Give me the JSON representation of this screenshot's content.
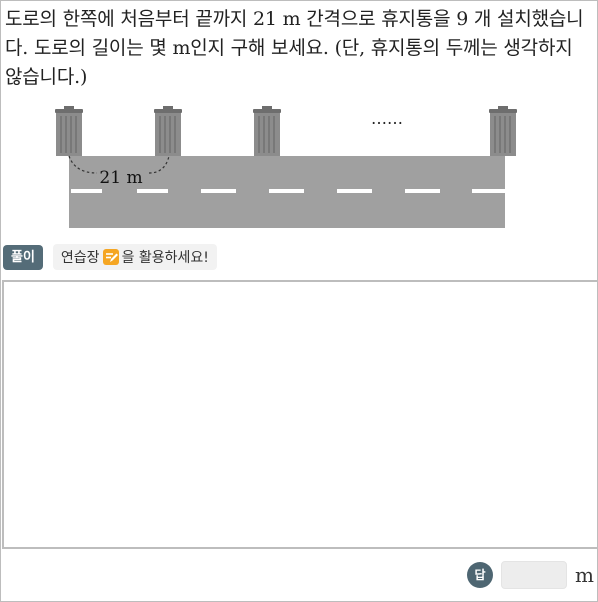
{
  "question": {
    "text": "도로의 한쪽에 처음부터 끝까지 21 m 간격으로 휴지통을 9 개 설치했습니다. 도로의 길이는 몇 m인지 구해 보세요. (단, 휴지통의 두께는 생각하지 않습니다.)"
  },
  "figure": {
    "interval_label": "21 m",
    "ellipsis": "……",
    "colors": {
      "road": "#a0a0a0",
      "lane_mark": "#ffffff",
      "bin": "#8c8c8c"
    }
  },
  "toolbar": {
    "solve_label": "풀이",
    "hint_before": "연습장",
    "hint_after": "을 활용하세요!",
    "hint_icon": "notepad-pencil-icon"
  },
  "work_area": {
    "content": ""
  },
  "answer": {
    "badge_label": "답",
    "value": "",
    "unit": "m"
  }
}
